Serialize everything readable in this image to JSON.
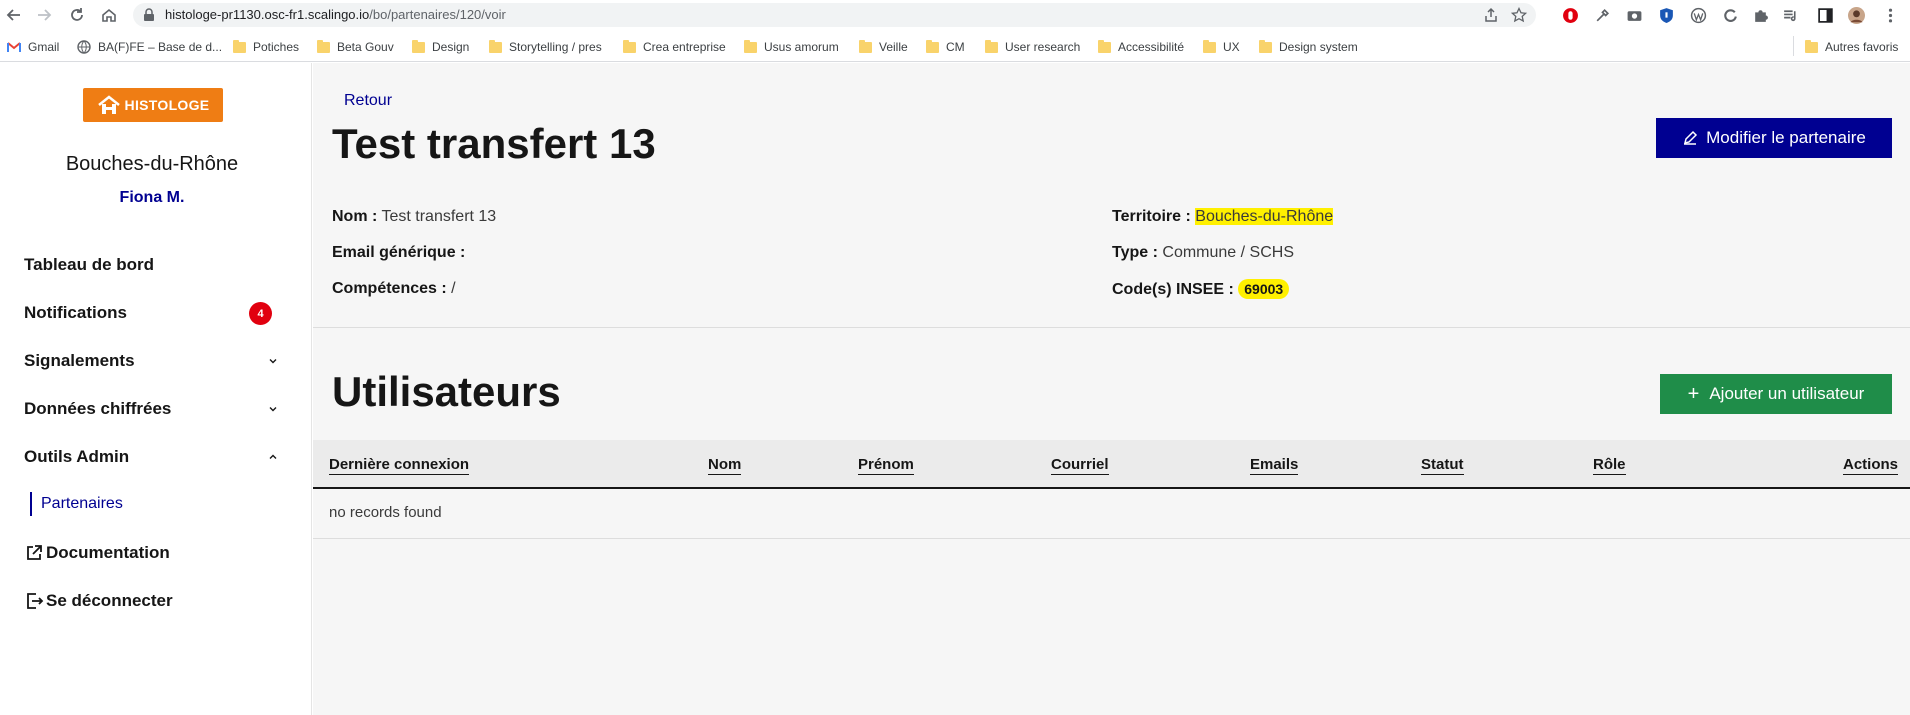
{
  "browser": {
    "url_host": "histologe-pr1130.osc-fr1.scalingo.io",
    "url_path": "/bo/partenaires/120/voir",
    "bookmarks": [
      {
        "label": "Gmail",
        "icon": "gmail-icon"
      },
      {
        "label": "BA(F)FE – Base de d...",
        "icon": "globe-icon"
      },
      {
        "label": "Potiches",
        "icon": "folder-icon"
      },
      {
        "label": "Beta Gouv",
        "icon": "folder-icon"
      },
      {
        "label": "Design",
        "icon": "folder-icon"
      },
      {
        "label": "Storytelling / pres",
        "icon": "folder-icon"
      },
      {
        "label": "Crea entreprise",
        "icon": "folder-icon"
      },
      {
        "label": "Usus amorum",
        "icon": "folder-icon"
      },
      {
        "label": "Veille",
        "icon": "folder-icon"
      },
      {
        "label": "CM",
        "icon": "folder-icon"
      },
      {
        "label": "User research",
        "icon": "folder-icon"
      },
      {
        "label": "Accessibilité",
        "icon": "folder-icon"
      },
      {
        "label": "UX",
        "icon": "folder-icon"
      },
      {
        "label": "Design system",
        "icon": "folder-icon"
      }
    ],
    "other_bookmarks": "Autres favoris"
  },
  "sidebar": {
    "logo_text": "HISTOLOGE",
    "territory": "Bouches-du-Rhône",
    "user": "Fiona M.",
    "menu": [
      {
        "label": "Tableau de bord"
      },
      {
        "label": "Notifications",
        "badge": "4"
      },
      {
        "label": "Signalements",
        "chevron": "chevron-down-icon"
      },
      {
        "label": "Données chiffrées",
        "chevron": "chevron-down-icon"
      },
      {
        "label": "Outils Admin",
        "chevron": "chevron-up-icon"
      }
    ],
    "sub_item": "Partenaires",
    "documentation": "Documentation",
    "logout": "Se déconnecter"
  },
  "main": {
    "back_link": "Retour",
    "title": "Test transfert 13",
    "edit_button": "Modifier le partenaire",
    "fields_left": [
      {
        "label": "Nom :",
        "value": "Test transfert 13"
      },
      {
        "label": "Email générique :",
        "value": ""
      },
      {
        "label": "Compétences :",
        "value": "/"
      }
    ],
    "fields_right": [
      {
        "label": "Territoire :",
        "value": "Bouches-du-Rhône"
      },
      {
        "label": "Type :",
        "value": "Commune / SCHS"
      },
      {
        "label": "Code(s) INSEE :",
        "value": "69003"
      }
    ],
    "users_title": "Utilisateurs",
    "add_user_button": "Ajouter un utilisateur",
    "table": {
      "columns": [
        "Dernière connexion",
        "Nom",
        "Prénom",
        "Courriel",
        "Emails",
        "Statut",
        "Rôle",
        "Actions"
      ],
      "empty_message": "no records found"
    }
  },
  "colors": {
    "primary": "#000091",
    "success": "#1f8d49",
    "logo": "#ef7d14",
    "badge": "#e1000f",
    "highlight": "#fff000"
  }
}
